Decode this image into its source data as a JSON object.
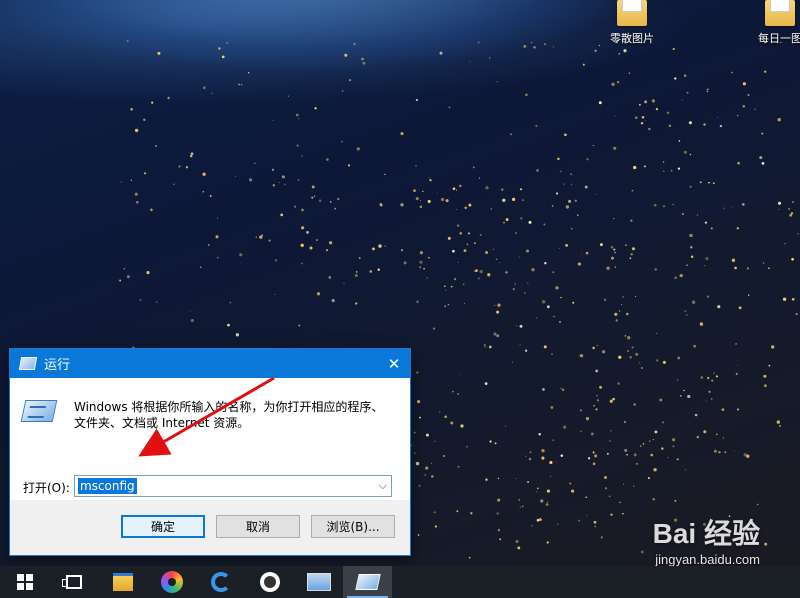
{
  "desktop": {
    "icons": [
      {
        "label": "零散图片",
        "icon": "folder-icon"
      },
      {
        "label": "每日一图",
        "icon": "folder-icon"
      }
    ]
  },
  "run_dialog": {
    "title": "运行",
    "close_glyph": "✕",
    "description": "Windows 将根据你所输入的名称，为你打开相应的程序、文件夹、文档或 Internet 资源。",
    "open_label": "打开(O):",
    "open_value": "msconfig",
    "buttons": {
      "ok": "确定",
      "cancel": "取消",
      "browse": "浏览(B)..."
    }
  },
  "watermark": {
    "logo": "Bai 经验",
    "url": "jingyan.baidu.com"
  },
  "taskbar": {
    "items": [
      {
        "name": "start-button",
        "icon": "windows-logo-icon"
      },
      {
        "name": "task-view-button",
        "icon": "task-view-icon"
      },
      {
        "name": "file-explorer-button",
        "icon": "folder-icon"
      },
      {
        "name": "app-ring-button",
        "icon": "color-ring-icon"
      },
      {
        "name": "edge-button",
        "icon": "edge-icon"
      },
      {
        "name": "obs-button",
        "icon": "obs-icon"
      },
      {
        "name": "monitor-app-button",
        "icon": "monitor-icon"
      },
      {
        "name": "run-app-button",
        "icon": "run-icon",
        "active": true
      }
    ]
  },
  "colors": {
    "titlebar": "#0a78d8",
    "selection": "#0a78d8",
    "annotation_arrow": "#e01010",
    "taskbar": "#1b1f26"
  }
}
